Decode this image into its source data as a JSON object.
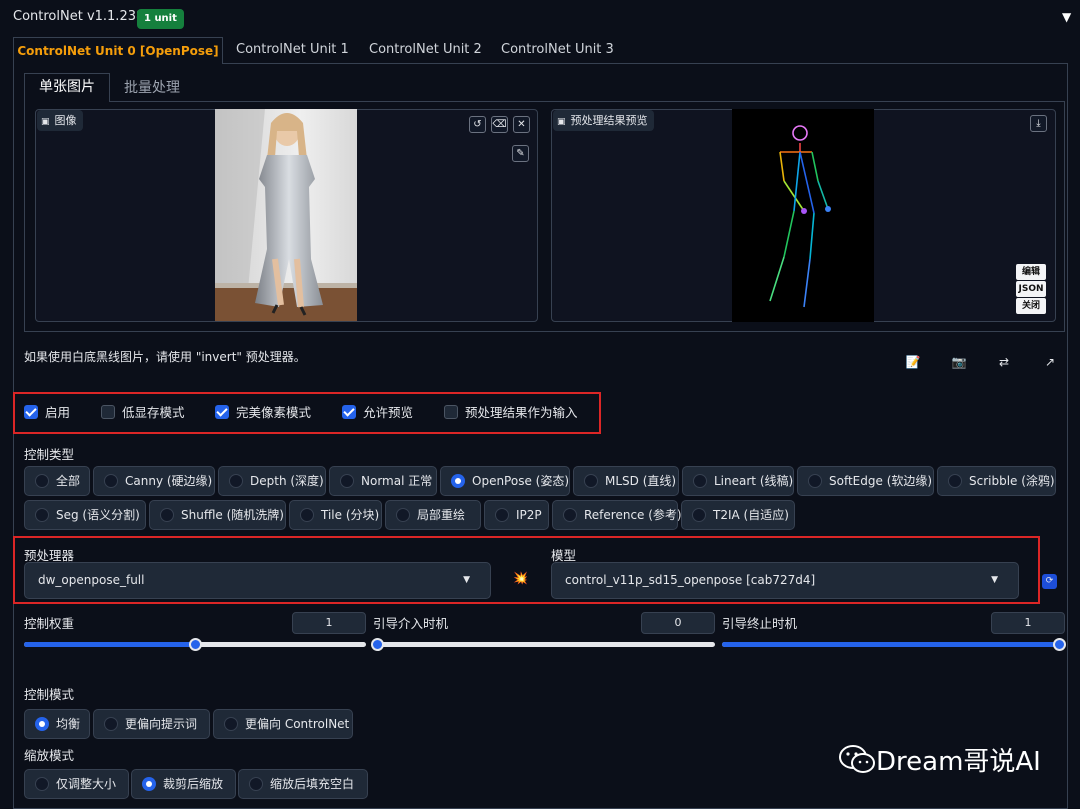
{
  "header": {
    "title": "ControlNet v1.1.238",
    "badge": "1 unit",
    "collapse_icon": "▼"
  },
  "tabs": [
    "ControlNet Unit 0 [OpenPose]",
    "ControlNet Unit 1",
    "ControlNet Unit 2",
    "ControlNet Unit 3"
  ],
  "subtabs": [
    "单张图片",
    "批量处理"
  ],
  "image_box": {
    "label": "图像",
    "buttons": [
      "↺",
      "⌫",
      "✕",
      "✎"
    ]
  },
  "preview_box": {
    "label": "预处理结果预览",
    "side_buttons": [
      "编辑",
      "JSON",
      "关闭"
    ]
  },
  "hint": "如果使用白底黑线图片，请使用 \"invert\" 预处理器。",
  "tools": [
    "📝",
    "📷",
    "⇄",
    "↗"
  ],
  "checkboxes": [
    {
      "label": "启用",
      "checked": true
    },
    {
      "label": "低显存模式",
      "checked": false
    },
    {
      "label": "完美像素模式",
      "checked": true
    },
    {
      "label": "允许预览",
      "checked": true
    },
    {
      "label": "预处理结果作为输入",
      "checked": false
    }
  ],
  "control_type": {
    "label": "控制类型",
    "options": [
      "全部",
      "Canny (硬边缘)",
      "Depth (深度)",
      "Normal 正常",
      "OpenPose (姿态)",
      "MLSD (直线)",
      "Lineart (线稿)",
      "SoftEdge (软边缘)",
      "Scribble (涂鸦)",
      "Seg (语义分割)",
      "Shuffle (随机洗牌)",
      "Tile (分块)",
      "局部重绘",
      "IP2P",
      "Reference (参考)",
      "T2IA (自适应)"
    ],
    "selected": "OpenPose (姿态)"
  },
  "preprocessor": {
    "label": "预处理器",
    "value": "dw_openpose_full",
    "run_icon": "💥"
  },
  "model": {
    "label": "模型",
    "value": "control_v11p_sd15_openpose [cab727d4]",
    "refresh_icon": "🔄"
  },
  "sliders": [
    {
      "label": "控制权重",
      "value": "1",
      "fraction": 0.5
    },
    {
      "label": "引导介入时机",
      "value": "0",
      "fraction": 0.0
    },
    {
      "label": "引导终止时机",
      "value": "1",
      "fraction": 1.0
    }
  ],
  "control_mode": {
    "label": "控制模式",
    "options": [
      "均衡",
      "更偏向提示词",
      "更偏向 ControlNet"
    ],
    "selected": "均衡"
  },
  "resize_mode": {
    "label": "缩放模式",
    "options": [
      "仅调整大小",
      "裁剪后缩放",
      "缩放后填充空白"
    ],
    "selected": "裁剪后缩放"
  },
  "watermark": "Dream哥说AI",
  "colors": {
    "accent": "#2563eb",
    "badge": "#15803d",
    "active_tab": "#f59e0b",
    "highlight": "#dc2626"
  }
}
